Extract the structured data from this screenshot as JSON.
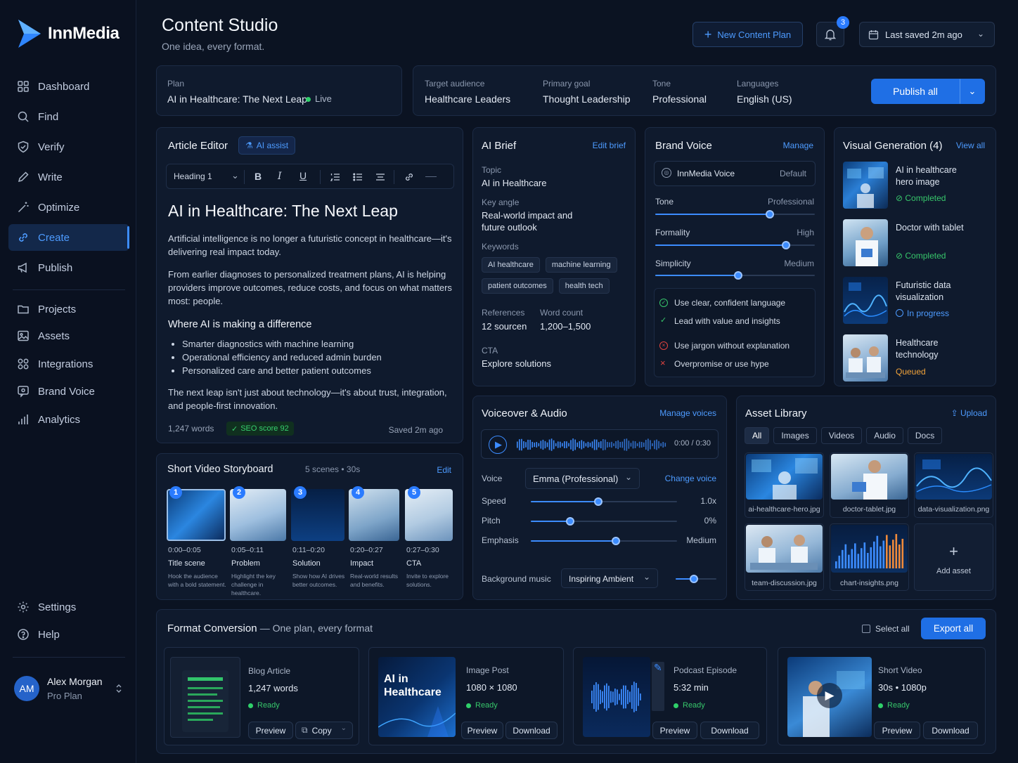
{
  "app": {
    "name": "InnMedia"
  },
  "header": {
    "title": "Content Studio",
    "subtitle": "One idea, every format.",
    "new_plan": "New Content Plan",
    "notifications": "3",
    "saved": "Last saved 2m ago"
  },
  "sidebar": {
    "items": [
      {
        "label": "Dashboard",
        "icon": "grid-icon"
      },
      {
        "label": "Find",
        "icon": "search-icon"
      },
      {
        "label": "Verify",
        "icon": "shield-icon"
      },
      {
        "label": "Write",
        "icon": "pen-icon"
      },
      {
        "label": "Optimize",
        "icon": "wand-icon"
      },
      {
        "label": "Create",
        "icon": "link-icon",
        "active": true
      },
      {
        "label": "Publish",
        "icon": "megaphone-icon"
      }
    ],
    "items2": [
      {
        "label": "Projects",
        "icon": "folder-icon"
      },
      {
        "label": "Assets",
        "icon": "image-icon"
      },
      {
        "label": "Integrations",
        "icon": "apps-icon"
      },
      {
        "label": "Brand Voice",
        "icon": "voice-icon"
      },
      {
        "label": "Analytics",
        "icon": "chart-icon"
      }
    ],
    "settings": "Settings",
    "help": "Help",
    "user": {
      "initials": "AM",
      "name": "Alex Morgan",
      "plan": "Pro Plan"
    }
  },
  "plan": {
    "label": "Plan",
    "value": "AI in Healthcare: The Next Leap",
    "status": "Live"
  },
  "meta": {
    "audience_label": "Target audience",
    "audience": "Healthcare Leaders",
    "goal_label": "Primary goal",
    "goal": "Thought Leadership",
    "tone_label": "Tone",
    "tone": "Professional",
    "lang_label": "Languages",
    "lang": "English (US)",
    "publish": "Publish all"
  },
  "editor": {
    "title": "Article Editor",
    "ai_assist": "AI assist",
    "heading_select": "Heading 1",
    "article_title": "AI in Healthcare: The Next Leap",
    "p1": "Artificial intelligence is no longer a futuristic concept in healthcare—it's delivering real impact today.",
    "p2": "From earlier diagnoses to personalized treatment plans, AI is helping providers improve outcomes, reduce costs, and focus on what matters most: people.",
    "h2": "Where AI is making a difference",
    "bullets": [
      "Smarter diagnostics with machine learning",
      "Operational efficiency and reduced admin burden",
      "Personalized care and better patient outcomes"
    ],
    "p3": "The next leap isn't just about technology—it's about trust, integration, and people-first innovation.",
    "words": "1,247 words",
    "seo": "SEO score 92",
    "saved": "Saved 2m ago"
  },
  "brief": {
    "title": "AI Brief",
    "edit": "Edit brief",
    "topic_label": "Topic",
    "topic": "AI in Healthcare",
    "angle_label": "Key angle",
    "angle": "Real-world impact and future outlook",
    "keywords_label": "Keywords",
    "keywords": [
      "AI healthcare",
      "machine learning",
      "patient outcomes",
      "health tech"
    ],
    "refs_label": "References",
    "refs": "12 sourcen",
    "wc_label": "Word count",
    "wc": "1,200–1,500",
    "cta_label": "CTA",
    "cta": "Explore solutions"
  },
  "voice": {
    "title": "Brand Voice",
    "manage": "Manage",
    "name": "InnMedia Voice",
    "default": "Default",
    "sliders": [
      {
        "label": "Tone",
        "value": "Professional",
        "level": 0.72
      },
      {
        "label": "Formality",
        "value": "High",
        "level": 0.82
      },
      {
        "label": "Simplicity",
        "value": "Medium",
        "level": 0.52
      }
    ],
    "do": [
      "Use clear, confident language",
      "Lead with value and insights"
    ],
    "dont": [
      "Use jargon without explanation",
      "Overpromise or use hype"
    ]
  },
  "visual": {
    "title": "Visual Generation (4)",
    "view_all": "View all",
    "items": [
      {
        "name": "AI in healthcare hero image",
        "status": "Completed"
      },
      {
        "name": "Doctor with tablet",
        "status": "Completed"
      },
      {
        "name": "Futuristic data visualization",
        "status": "In progress"
      },
      {
        "name": "Healthcare technology",
        "status": "Queued"
      }
    ]
  },
  "storyboard": {
    "title": "Short Video Storyboard",
    "meta": "5 scenes • 30s",
    "edit": "Edit",
    "scenes": [
      {
        "n": "1",
        "time": "0:00–0:05",
        "name": "Title scene",
        "desc": "Hook the audience with a bold statement."
      },
      {
        "n": "2",
        "time": "0:05–0:11",
        "name": "Problem",
        "desc": "Highlight the key challenge in healthcare."
      },
      {
        "n": "3",
        "time": "0:11–0:20",
        "name": "Solution",
        "desc": "Show how AI drives better outcomes."
      },
      {
        "n": "4",
        "time": "0:20–0:27",
        "name": "Impact",
        "desc": "Real-world results and benefits."
      },
      {
        "n": "5",
        "time": "0:27–0:30",
        "name": "CTA",
        "desc": "Invite to explore solutions."
      }
    ]
  },
  "audio": {
    "title": "Voiceover & Audio",
    "manage": "Manage voices",
    "time": "0:00 / 0:30",
    "voice_label": "Voice",
    "voice": "Emma (Professional)",
    "change": "Change voice",
    "speed_label": "Speed",
    "speed": "1.0x",
    "speed_level": 0.46,
    "pitch_label": "Pitch",
    "pitch": "0%",
    "pitch_level": 0.27,
    "emph_label": "Emphasis",
    "emph": "Medium",
    "emph_level": 0.58,
    "bg_label": "Background music",
    "bg": "Inspiring Ambient",
    "bg_level": 0.45
  },
  "library": {
    "title": "Asset Library",
    "upload": "Upload",
    "tabs": [
      "All",
      "Images",
      "Videos",
      "Audio",
      "Docs"
    ],
    "assets": [
      "ai-healthcare-hero.jpg",
      "doctor-tablet.jpg",
      "data-visualization.png",
      "team-discussion.jpg",
      "chart-insights.png"
    ],
    "add": "Add asset"
  },
  "conversion": {
    "title": "Format Conversion",
    "subtitle": "— One plan, every format",
    "select_all": "Select all",
    "export": "Export all",
    "items": [
      {
        "name": "Blog Article",
        "detail": "1,247 words",
        "status": "Ready",
        "a": "Preview",
        "b": "Copy"
      },
      {
        "name": "Image Post",
        "detail": "1080 × 1080",
        "status": "Ready",
        "a": "Preview",
        "b": "Download",
        "thumb_text": "AI in Healthcare"
      },
      {
        "name": "Podcast Episode",
        "detail": "5:32 min",
        "status": "Ready",
        "a": "Preview",
        "b": "Download"
      },
      {
        "name": "Short Video",
        "detail": "30s • 1080p",
        "status": "Ready",
        "a": "Preview",
        "b": "Download"
      }
    ]
  },
  "colors": {
    "accent": "#3c8cff",
    "bg": "#0b1322",
    "card": "#0f1a2d",
    "success": "#37c76b",
    "warning": "#f0a23a"
  }
}
